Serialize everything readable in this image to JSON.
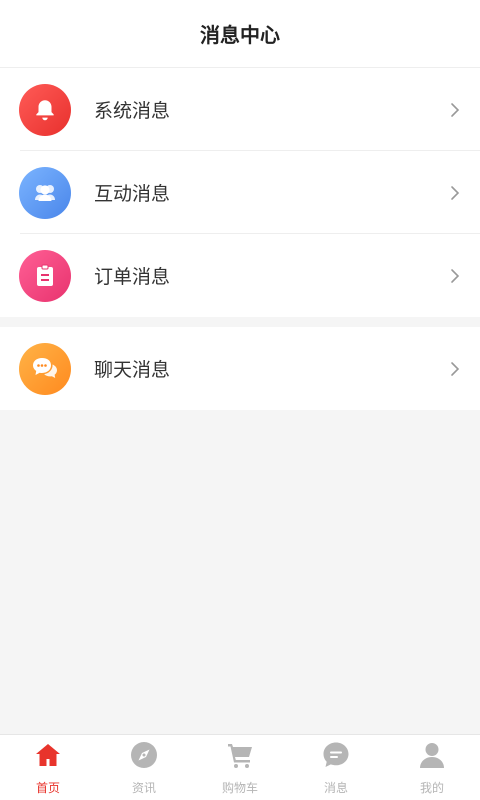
{
  "header": {
    "title": "消息中心"
  },
  "groups": [
    {
      "items": [
        {
          "label": "系统消息",
          "icon": "bell-icon"
        },
        {
          "label": "互动消息",
          "icon": "users-icon"
        },
        {
          "label": "订单消息",
          "icon": "clipboard-icon"
        }
      ]
    },
    {
      "items": [
        {
          "label": "聊天消息",
          "icon": "chat-bubbles-icon"
        }
      ]
    }
  ],
  "tabbar": {
    "tabs": [
      {
        "label": "首页",
        "icon": "home-icon",
        "active": true
      },
      {
        "label": "资讯",
        "icon": "compass-icon",
        "active": false
      },
      {
        "label": "购物车",
        "icon": "cart-icon",
        "active": false
      },
      {
        "label": "消息",
        "icon": "message-icon",
        "active": false
      },
      {
        "label": "我的",
        "icon": "user-icon",
        "active": false
      }
    ]
  },
  "colors": {
    "active": "#e8342c",
    "inactive": "#b5b5b5",
    "bell_bg": "#f0413d",
    "users_bg": "#5b9bf3",
    "clipboard_bg": "#f2477f",
    "chat_bg": "#ff9a33"
  }
}
